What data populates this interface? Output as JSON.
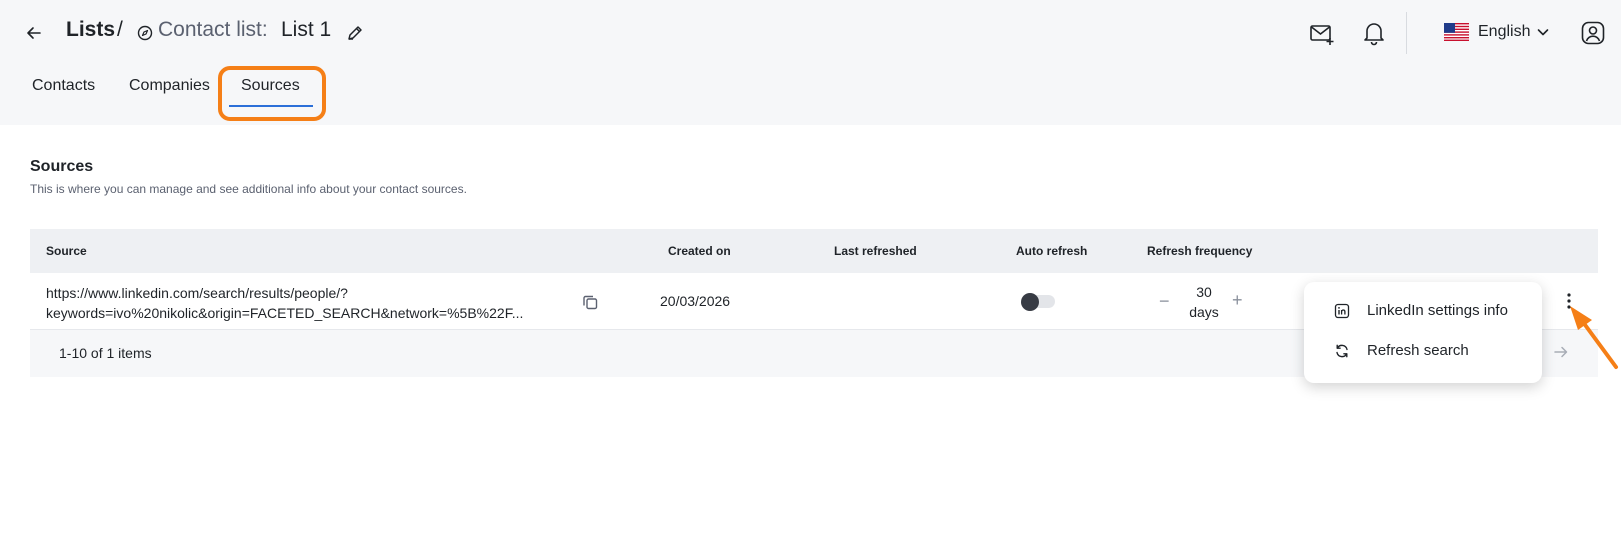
{
  "header": {
    "breadcrumb_root": "Lists",
    "breadcrumb_sep": "/",
    "list_type": "Contact list:",
    "list_name": "List 1",
    "language": "English"
  },
  "tabs": [
    {
      "label": "Contacts"
    },
    {
      "label": "Companies"
    },
    {
      "label": "Sources",
      "active": true
    }
  ],
  "section": {
    "title": "Sources",
    "description": "This is where you can manage and see additional info about your contact sources."
  },
  "table": {
    "columns": [
      "Source",
      "Created on",
      "Last refreshed",
      "Auto refresh",
      "Refresh frequency"
    ],
    "rows": [
      {
        "source_line1": "https://www.linkedin.com/search/results/people/?",
        "source_line2": "keywords=ivo%20nikolic&origin=FACETED_SEARCH&network=%5B%22F...",
        "created_on": "20/03/2026",
        "last_refreshed": "",
        "auto_refresh": false,
        "frequency_value": "30",
        "frequency_unit": "days"
      }
    ],
    "pagination": "1-10 of 1 items"
  },
  "row_menu": {
    "items": [
      {
        "label": "LinkedIn settings info",
        "icon": "linkedin-icon"
      },
      {
        "label": "Refresh search",
        "icon": "refresh-icon"
      }
    ]
  },
  "colors": {
    "highlight": "#f57f17",
    "tab_active": "#2b6fd8",
    "header_bg": "#f6f7f9"
  }
}
